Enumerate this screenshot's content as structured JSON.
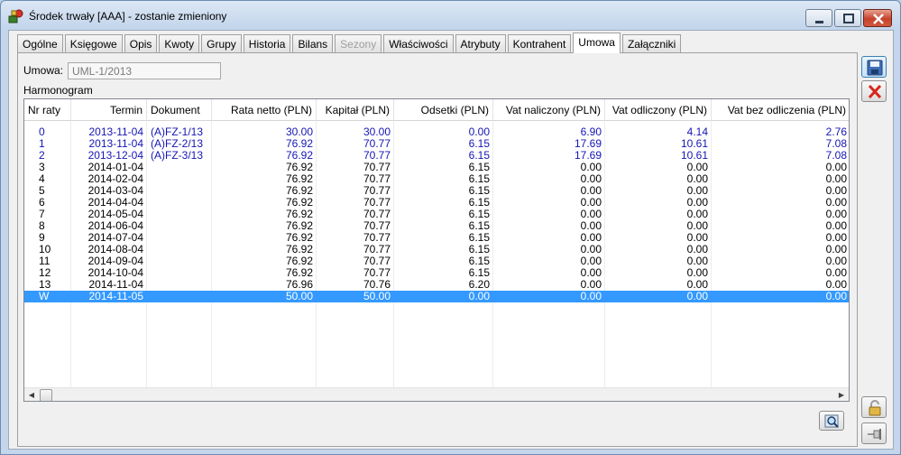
{
  "window": {
    "title": "Środek trwały [AAA] - zostanie zmieniony"
  },
  "tabs": [
    {
      "label": "Ogólne",
      "state": "normal"
    },
    {
      "label": "Księgowe",
      "state": "normal"
    },
    {
      "label": "Opis",
      "state": "normal"
    },
    {
      "label": "Kwoty",
      "state": "normal"
    },
    {
      "label": "Grupy",
      "state": "normal"
    },
    {
      "label": "Historia",
      "state": "normal"
    },
    {
      "label": "Bilans",
      "state": "normal"
    },
    {
      "label": "Sezony",
      "state": "disabled"
    },
    {
      "label": "Właściwości",
      "state": "normal"
    },
    {
      "label": "Atrybuty",
      "state": "normal"
    },
    {
      "label": "Kontrahent",
      "state": "normal"
    },
    {
      "label": "Umowa",
      "state": "active"
    },
    {
      "label": "Załączniki",
      "state": "normal"
    }
  ],
  "form": {
    "umowa_label": "Umowa:",
    "umowa_value": "UML-1/2013",
    "harmonogram_label": "Harmonogram"
  },
  "grid": {
    "columns": [
      "Nr raty",
      "Termin",
      "Dokument",
      "Rata netto (PLN)",
      "Kapitał (PLN)",
      "Odsetki (PLN)",
      "Vat naliczony (PLN)",
      "Vat odliczony (PLN)",
      "Vat bez odliczenia (PLN)"
    ],
    "rows": [
      {
        "nr": "0",
        "termin": "2013-11-04",
        "dokument": "(A)FZ-1/13",
        "rata": "30.00",
        "kapital": "30.00",
        "odsetki": "0.00",
        "vat_nal": "6.90",
        "vat_odl": "4.14",
        "vat_bez": "2.76",
        "style": "blue"
      },
      {
        "nr": "1",
        "termin": "2013-11-04",
        "dokument": "(A)FZ-2/13",
        "rata": "76.92",
        "kapital": "70.77",
        "odsetki": "6.15",
        "vat_nal": "17.69",
        "vat_odl": "10.61",
        "vat_bez": "7.08",
        "style": "blue"
      },
      {
        "nr": "2",
        "termin": "2013-12-04",
        "dokument": "(A)FZ-3/13",
        "rata": "76.92",
        "kapital": "70.77",
        "odsetki": "6.15",
        "vat_nal": "17.69",
        "vat_odl": "10.61",
        "vat_bez": "7.08",
        "style": "blue"
      },
      {
        "nr": "3",
        "termin": "2014-01-04",
        "dokument": "",
        "rata": "76.92",
        "kapital": "70.77",
        "odsetki": "6.15",
        "vat_nal": "0.00",
        "vat_odl": "0.00",
        "vat_bez": "0.00",
        "style": "normal"
      },
      {
        "nr": "4",
        "termin": "2014-02-04",
        "dokument": "",
        "rata": "76.92",
        "kapital": "70.77",
        "odsetki": "6.15",
        "vat_nal": "0.00",
        "vat_odl": "0.00",
        "vat_bez": "0.00",
        "style": "normal"
      },
      {
        "nr": "5",
        "termin": "2014-03-04",
        "dokument": "",
        "rata": "76.92",
        "kapital": "70.77",
        "odsetki": "6.15",
        "vat_nal": "0.00",
        "vat_odl": "0.00",
        "vat_bez": "0.00",
        "style": "normal"
      },
      {
        "nr": "6",
        "termin": "2014-04-04",
        "dokument": "",
        "rata": "76.92",
        "kapital": "70.77",
        "odsetki": "6.15",
        "vat_nal": "0.00",
        "vat_odl": "0.00",
        "vat_bez": "0.00",
        "style": "normal"
      },
      {
        "nr": "7",
        "termin": "2014-05-04",
        "dokument": "",
        "rata": "76.92",
        "kapital": "70.77",
        "odsetki": "6.15",
        "vat_nal": "0.00",
        "vat_odl": "0.00",
        "vat_bez": "0.00",
        "style": "normal"
      },
      {
        "nr": "8",
        "termin": "2014-06-04",
        "dokument": "",
        "rata": "76.92",
        "kapital": "70.77",
        "odsetki": "6.15",
        "vat_nal": "0.00",
        "vat_odl": "0.00",
        "vat_bez": "0.00",
        "style": "normal"
      },
      {
        "nr": "9",
        "termin": "2014-07-04",
        "dokument": "",
        "rata": "76.92",
        "kapital": "70.77",
        "odsetki": "6.15",
        "vat_nal": "0.00",
        "vat_odl": "0.00",
        "vat_bez": "0.00",
        "style": "normal"
      },
      {
        "nr": "10",
        "termin": "2014-08-04",
        "dokument": "",
        "rata": "76.92",
        "kapital": "70.77",
        "odsetki": "6.15",
        "vat_nal": "0.00",
        "vat_odl": "0.00",
        "vat_bez": "0.00",
        "style": "normal"
      },
      {
        "nr": "11",
        "termin": "2014-09-04",
        "dokument": "",
        "rata": "76.92",
        "kapital": "70.77",
        "odsetki": "6.15",
        "vat_nal": "0.00",
        "vat_odl": "0.00",
        "vat_bez": "0.00",
        "style": "normal"
      },
      {
        "nr": "12",
        "termin": "2014-10-04",
        "dokument": "",
        "rata": "76.92",
        "kapital": "70.77",
        "odsetki": "6.15",
        "vat_nal": "0.00",
        "vat_odl": "0.00",
        "vat_bez": "0.00",
        "style": "normal"
      },
      {
        "nr": "13",
        "termin": "2014-11-04",
        "dokument": "",
        "rata": "76.96",
        "kapital": "70.76",
        "odsetki": "6.20",
        "vat_nal": "0.00",
        "vat_odl": "0.00",
        "vat_bez": "0.00",
        "style": "normal"
      },
      {
        "nr": "W",
        "termin": "2014-11-05",
        "dokument": "",
        "rata": "50.00",
        "kapital": "50.00",
        "odsetki": "0.00",
        "vat_nal": "0.00",
        "vat_odl": "0.00",
        "vat_bez": "0.00",
        "style": "selected"
      }
    ]
  },
  "icons": {
    "app": "fixed-asset-icon",
    "save": "save-icon",
    "cancel": "close-icon",
    "zoom": "magnifier-icon",
    "lock": "padlock-icon",
    "pin": "pin-icon"
  },
  "colors": {
    "selection": "#3399ff",
    "document_rows": "#1515b5",
    "close_button": "#c7422b"
  }
}
